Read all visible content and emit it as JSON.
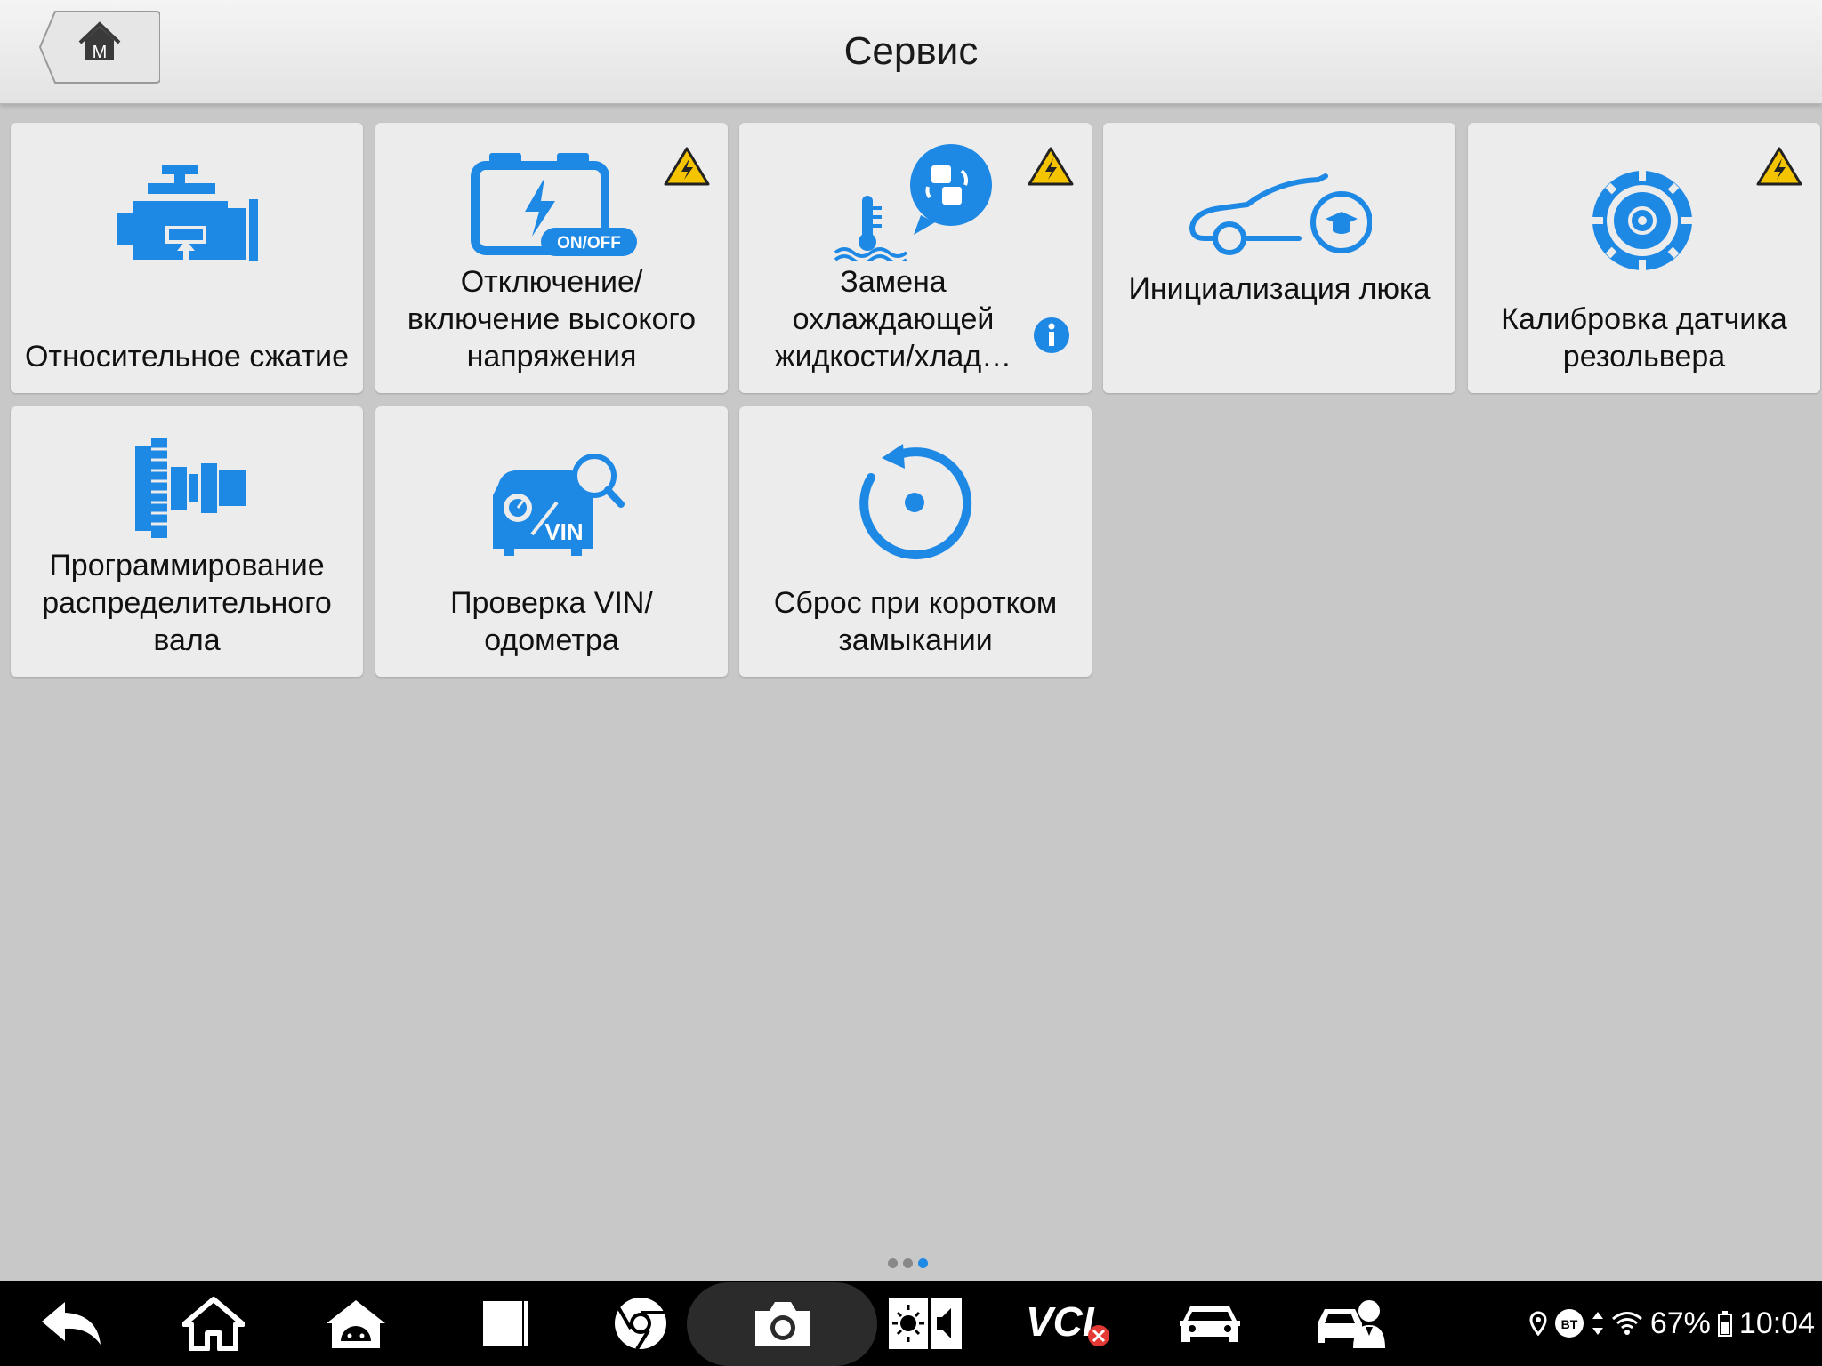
{
  "header": {
    "title": "Сервис",
    "home_letter": "M"
  },
  "tiles": [
    {
      "label": "Относительное сжатие",
      "icon": "engine-compression-icon",
      "warning": false
    },
    {
      "label": "Отключение/ включение высокого напряжения",
      "icon": "battery-onoff-icon",
      "badge": "ON/OFF",
      "warning": true
    },
    {
      "label": "Замена охлаждающей жидкости/хлад…",
      "icon": "coolant-replace-icon",
      "warning": true,
      "info": true
    },
    {
      "label": "Инициализация люка",
      "icon": "sunroof-learn-icon",
      "warning": false
    },
    {
      "label": "Калибровка датчика резольвера",
      "icon": "resolver-gear-icon",
      "warning": true
    },
    {
      "label": "Программирование распределительного вала",
      "icon": "camshaft-icon",
      "warning": false
    },
    {
      "label": "Проверка VIN/ одометра",
      "icon": "vin-odometer-icon",
      "badge": "VIN",
      "warning": false
    },
    {
      "label": "Сброс при коротком замыкании",
      "icon": "short-circuit-reset-icon",
      "warning": false
    }
  ],
  "pager": {
    "pages": 3,
    "current": 3
  },
  "navbar": {
    "items": [
      "back-icon",
      "home-icon",
      "android-icon",
      "recent-apps-icon",
      "chrome-icon",
      "camera-icon",
      "brightness-volume-icon",
      "vci-icon",
      "car-icon",
      "car-service-icon"
    ],
    "vci_label": "VCI"
  },
  "status": {
    "battery": "67%",
    "time": "10:04",
    "bt_label": "BT"
  },
  "colors": {
    "accent": "#1e88e5",
    "warning": "#f5c400"
  }
}
